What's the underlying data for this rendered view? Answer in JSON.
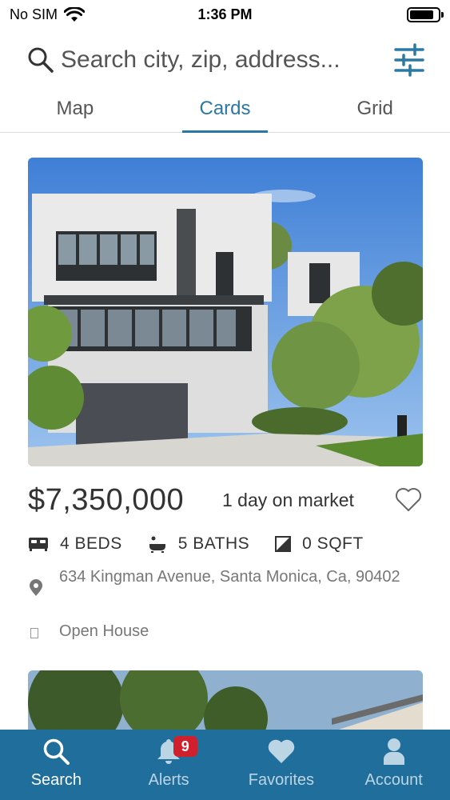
{
  "status_bar": {
    "carrier": "No SIM",
    "time": "1:36 PM",
    "battery_level": 0.85
  },
  "search": {
    "placeholder": "Search city, zip, address..."
  },
  "tabs": [
    {
      "label": "Map",
      "active": false
    },
    {
      "label": "Cards",
      "active": true
    },
    {
      "label": "Grid",
      "active": false
    }
  ],
  "listing": {
    "price": "$7,350,000",
    "days_on_market": "1 day on market",
    "beds": "4 BEDS",
    "baths": "5 BATHS",
    "sqft": "0 SQFT",
    "address": "634 Kingman Avenue, Santa Monica, Ca, 90402",
    "open_house": "Open House"
  },
  "bottom_nav": {
    "items": [
      {
        "label": "Search",
        "icon": "search-icon",
        "active": true
      },
      {
        "label": "Alerts",
        "icon": "bell-icon",
        "active": false,
        "badge": "9"
      },
      {
        "label": "Favorites",
        "icon": "heart-icon",
        "active": false
      },
      {
        "label": "Account",
        "icon": "person-icon",
        "active": false
      }
    ]
  },
  "colors": {
    "accent": "#2b78a5",
    "nav_background": "#1f6e9b",
    "badge": "#d0202e"
  }
}
